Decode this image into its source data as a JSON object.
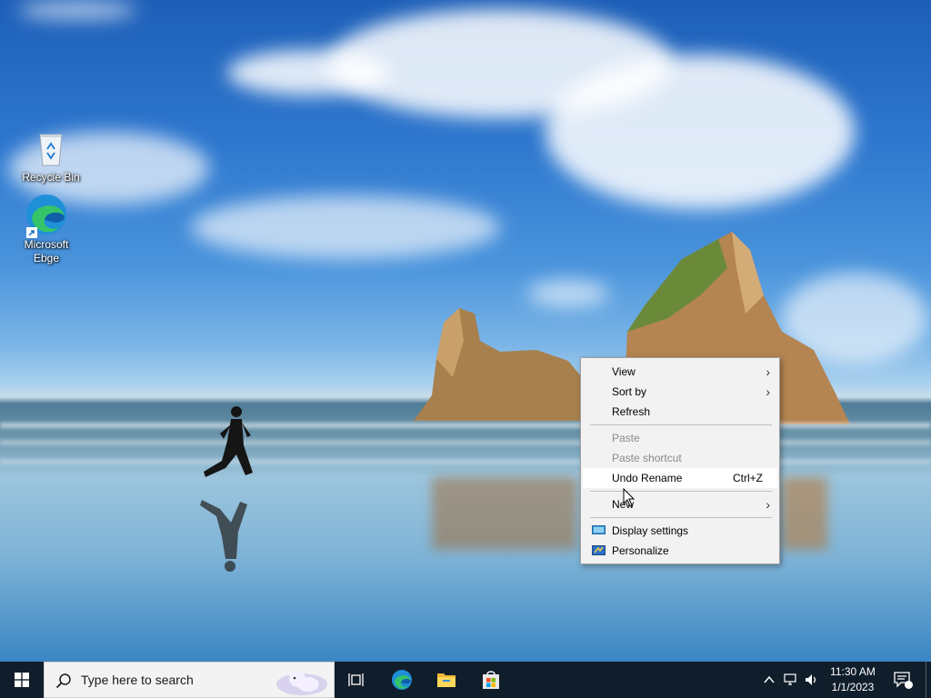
{
  "desktop": {
    "icons": [
      {
        "label": "Recycle Bin",
        "icon": "recycle-bin-icon"
      },
      {
        "label": "Microsoft Ebge",
        "icon": "edge-icon"
      }
    ]
  },
  "context_menu": {
    "items": [
      {
        "label": "View",
        "submenu": true
      },
      {
        "label": "Sort by",
        "submenu": true
      },
      {
        "label": "Refresh"
      },
      {
        "label": "Paste",
        "disabled": true
      },
      {
        "label": "Paste shortcut",
        "disabled": true
      },
      {
        "label": "Undo Rename",
        "shortcut": "Ctrl+Z",
        "hover": true
      },
      {
        "label": "New",
        "submenu": true
      },
      {
        "label": "Display settings",
        "icon": "display-icon"
      },
      {
        "label": "Personalize",
        "icon": "personalize-icon"
      }
    ]
  },
  "taskbar": {
    "search_placeholder": "Type here to search",
    "pinned": [
      "task-view-icon",
      "edge-icon",
      "file-explorer-icon",
      "store-icon"
    ],
    "clock": {
      "time": "11:30 AM",
      "date": "1/1/2023"
    }
  },
  "colors": {
    "taskbar_bg": "#101e2b",
    "menu_bg": "#f2f2f2",
    "menu_hover": "#ffffff",
    "disabled_text": "#8a8a8a"
  }
}
